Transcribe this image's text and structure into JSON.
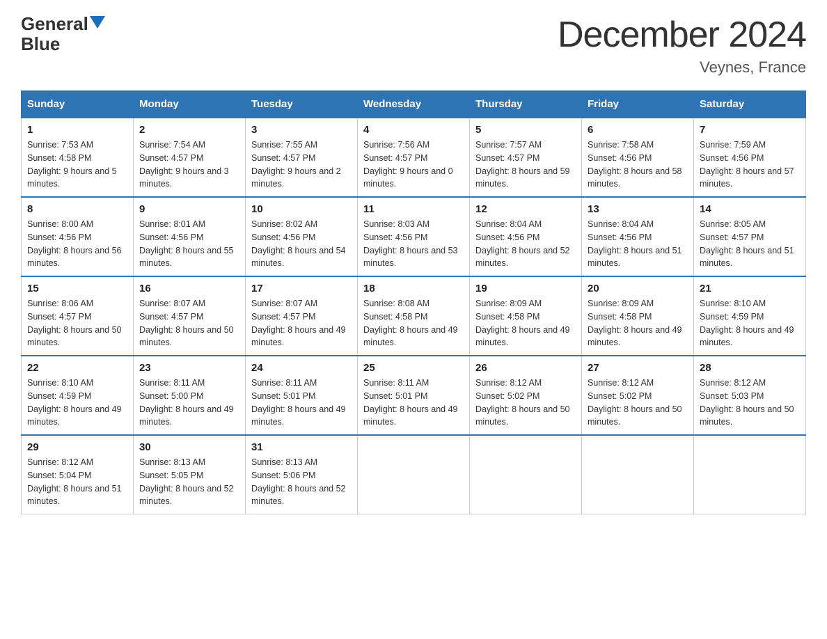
{
  "header": {
    "logo_general": "General",
    "logo_blue": "Blue",
    "month_title": "December 2024",
    "location": "Veynes, France"
  },
  "days_of_week": [
    "Sunday",
    "Monday",
    "Tuesday",
    "Wednesday",
    "Thursday",
    "Friday",
    "Saturday"
  ],
  "weeks": [
    [
      {
        "day": "1",
        "sunrise": "7:53 AM",
        "sunset": "4:58 PM",
        "daylight": "9 hours and 5 minutes."
      },
      {
        "day": "2",
        "sunrise": "7:54 AM",
        "sunset": "4:57 PM",
        "daylight": "9 hours and 3 minutes."
      },
      {
        "day": "3",
        "sunrise": "7:55 AM",
        "sunset": "4:57 PM",
        "daylight": "9 hours and 2 minutes."
      },
      {
        "day": "4",
        "sunrise": "7:56 AM",
        "sunset": "4:57 PM",
        "daylight": "9 hours and 0 minutes."
      },
      {
        "day": "5",
        "sunrise": "7:57 AM",
        "sunset": "4:57 PM",
        "daylight": "8 hours and 59 minutes."
      },
      {
        "day": "6",
        "sunrise": "7:58 AM",
        "sunset": "4:56 PM",
        "daylight": "8 hours and 58 minutes."
      },
      {
        "day": "7",
        "sunrise": "7:59 AM",
        "sunset": "4:56 PM",
        "daylight": "8 hours and 57 minutes."
      }
    ],
    [
      {
        "day": "8",
        "sunrise": "8:00 AM",
        "sunset": "4:56 PM",
        "daylight": "8 hours and 56 minutes."
      },
      {
        "day": "9",
        "sunrise": "8:01 AM",
        "sunset": "4:56 PM",
        "daylight": "8 hours and 55 minutes."
      },
      {
        "day": "10",
        "sunrise": "8:02 AM",
        "sunset": "4:56 PM",
        "daylight": "8 hours and 54 minutes."
      },
      {
        "day": "11",
        "sunrise": "8:03 AM",
        "sunset": "4:56 PM",
        "daylight": "8 hours and 53 minutes."
      },
      {
        "day": "12",
        "sunrise": "8:04 AM",
        "sunset": "4:56 PM",
        "daylight": "8 hours and 52 minutes."
      },
      {
        "day": "13",
        "sunrise": "8:04 AM",
        "sunset": "4:56 PM",
        "daylight": "8 hours and 51 minutes."
      },
      {
        "day": "14",
        "sunrise": "8:05 AM",
        "sunset": "4:57 PM",
        "daylight": "8 hours and 51 minutes."
      }
    ],
    [
      {
        "day": "15",
        "sunrise": "8:06 AM",
        "sunset": "4:57 PM",
        "daylight": "8 hours and 50 minutes."
      },
      {
        "day": "16",
        "sunrise": "8:07 AM",
        "sunset": "4:57 PM",
        "daylight": "8 hours and 50 minutes."
      },
      {
        "day": "17",
        "sunrise": "8:07 AM",
        "sunset": "4:57 PM",
        "daylight": "8 hours and 49 minutes."
      },
      {
        "day": "18",
        "sunrise": "8:08 AM",
        "sunset": "4:58 PM",
        "daylight": "8 hours and 49 minutes."
      },
      {
        "day": "19",
        "sunrise": "8:09 AM",
        "sunset": "4:58 PM",
        "daylight": "8 hours and 49 minutes."
      },
      {
        "day": "20",
        "sunrise": "8:09 AM",
        "sunset": "4:58 PM",
        "daylight": "8 hours and 49 minutes."
      },
      {
        "day": "21",
        "sunrise": "8:10 AM",
        "sunset": "4:59 PM",
        "daylight": "8 hours and 49 minutes."
      }
    ],
    [
      {
        "day": "22",
        "sunrise": "8:10 AM",
        "sunset": "4:59 PM",
        "daylight": "8 hours and 49 minutes."
      },
      {
        "day": "23",
        "sunrise": "8:11 AM",
        "sunset": "5:00 PM",
        "daylight": "8 hours and 49 minutes."
      },
      {
        "day": "24",
        "sunrise": "8:11 AM",
        "sunset": "5:01 PM",
        "daylight": "8 hours and 49 minutes."
      },
      {
        "day": "25",
        "sunrise": "8:11 AM",
        "sunset": "5:01 PM",
        "daylight": "8 hours and 49 minutes."
      },
      {
        "day": "26",
        "sunrise": "8:12 AM",
        "sunset": "5:02 PM",
        "daylight": "8 hours and 50 minutes."
      },
      {
        "day": "27",
        "sunrise": "8:12 AM",
        "sunset": "5:02 PM",
        "daylight": "8 hours and 50 minutes."
      },
      {
        "day": "28",
        "sunrise": "8:12 AM",
        "sunset": "5:03 PM",
        "daylight": "8 hours and 50 minutes."
      }
    ],
    [
      {
        "day": "29",
        "sunrise": "8:12 AM",
        "sunset": "5:04 PM",
        "daylight": "8 hours and 51 minutes."
      },
      {
        "day": "30",
        "sunrise": "8:13 AM",
        "sunset": "5:05 PM",
        "daylight": "8 hours and 52 minutes."
      },
      {
        "day": "31",
        "sunrise": "8:13 AM",
        "sunset": "5:06 PM",
        "daylight": "8 hours and 52 minutes."
      },
      null,
      null,
      null,
      null
    ]
  ],
  "labels": {
    "sunrise": "Sunrise:",
    "sunset": "Sunset:",
    "daylight": "Daylight:"
  }
}
